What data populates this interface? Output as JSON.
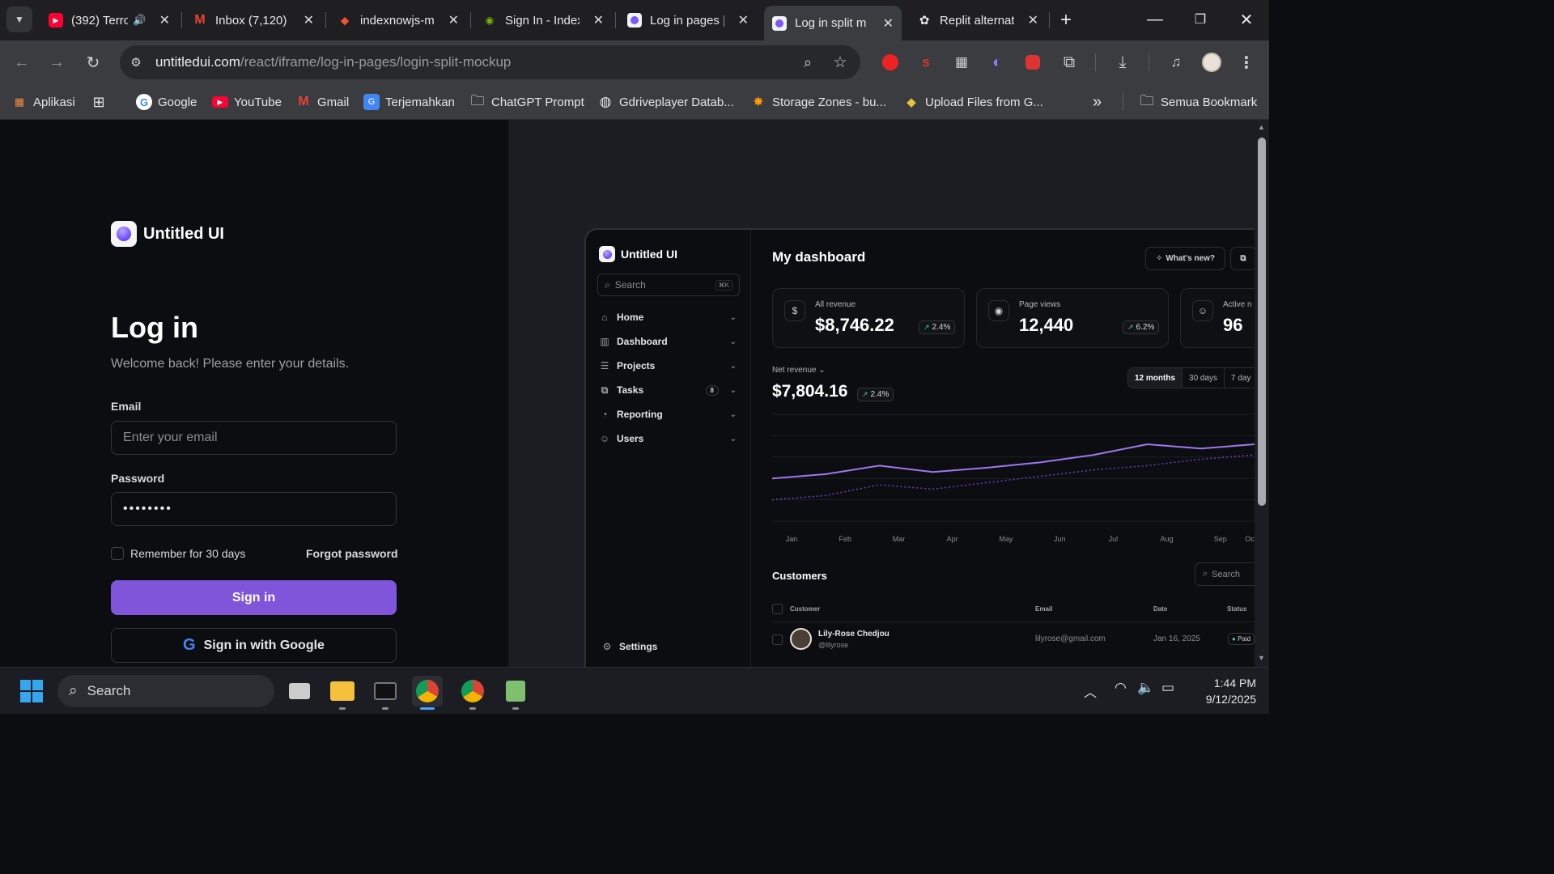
{
  "browser": {
    "tabs": [
      {
        "title": "(392) Terro",
        "icon": "youtube-icon"
      },
      {
        "title": "Inbox (7,120) -",
        "icon": "gmail-icon"
      },
      {
        "title": "indexnowjs-m",
        "icon": "git-icon"
      },
      {
        "title": "Sign In - Index",
        "icon": "nvidia-icon"
      },
      {
        "title": "Log in pages |",
        "icon": "untitledui-icon"
      },
      {
        "title": "Log in split m",
        "icon": "untitledui-icon"
      },
      {
        "title": "Replit alternat",
        "icon": "openai-icon"
      }
    ],
    "url_domain": "untitledui.com",
    "url_path": "/react/iframe/log-in-pages/login-split-mockup",
    "bookmarks": [
      "Aplikasi",
      "Google",
      "YouTube",
      "Gmail",
      "Terjemahkan",
      "ChatGPT Prompt",
      "Gdriveplayer Datab...",
      "Storage Zones - bu...",
      "Upload Files from G..."
    ],
    "all_bookmarks": "Semua Bookmark"
  },
  "login": {
    "brand": "Untitled UI",
    "heading": "Log in",
    "subtitle": "Welcome back! Please enter your details.",
    "email_label": "Email",
    "email_placeholder": "Enter your email",
    "password_label": "Password",
    "password_value": "••••••••",
    "remember": "Remember for 30 days",
    "forgot": "Forgot password",
    "signin": "Sign in",
    "google": "Sign in with Google"
  },
  "dashboard": {
    "brand": "Untitled UI",
    "search_placeholder": "Search",
    "search_shortcut": "⌘K",
    "nav": [
      {
        "label": "Home",
        "icon": "home-icon"
      },
      {
        "label": "Dashboard",
        "icon": "chart-icon"
      },
      {
        "label": "Projects",
        "icon": "layers-icon"
      },
      {
        "label": "Tasks",
        "icon": "tasks-icon",
        "badge": "8"
      },
      {
        "label": "Reporting",
        "icon": "pie-icon"
      },
      {
        "label": "Users",
        "icon": "users-icon"
      }
    ],
    "settings": "Settings",
    "title": "My dashboard",
    "whats_new": "What's new?",
    "cards": [
      {
        "label": "All revenue",
        "value": "$8,746.22",
        "change": "2.4%",
        "icon": "dollar-icon"
      },
      {
        "label": "Page views",
        "value": "12,440",
        "change": "6.2%",
        "icon": "eye-icon"
      },
      {
        "label": "Active n",
        "value": "96",
        "icon": "user-circle-icon"
      }
    ],
    "net_revenue_label": "Net revenue",
    "net_revenue_value": "$7,804.16",
    "net_revenue_change": "2.4%",
    "range_tabs": [
      "12 months",
      "30 days",
      "7 day"
    ],
    "customers_title": "Customers",
    "customers_search": "Search",
    "columns": [
      "Customer",
      "Email",
      "Date",
      "Status"
    ],
    "rows": [
      {
        "name": "Lily-Rose Chedjou",
        "handle": "@lilyrose",
        "email": "lilyrose@gmail.com",
        "date": "Jan 16, 2025",
        "status": "Paid"
      }
    ]
  },
  "chart_data": {
    "type": "line",
    "categories": [
      "Jan",
      "Feb",
      "Mar",
      "Apr",
      "May",
      "Jun",
      "Jul",
      "Aug",
      "Sep",
      "Oc"
    ],
    "series": [
      {
        "values": [
          40,
          44,
          52,
          46,
          50,
          55,
          62,
          72,
          68,
          72
        ]
      },
      {
        "values": [
          20,
          24,
          34,
          30,
          36,
          42,
          48,
          52,
          58,
          62
        ]
      }
    ],
    "ylim": [
      0,
      100
    ],
    "grid": true,
    "colors": {
      "primary": "#9e77ed",
      "secondary": "#6941c6"
    }
  },
  "taskbar": {
    "search": "Search",
    "time": "1:44 PM",
    "date": "9/12/2025"
  },
  "colors": {
    "accent": "#7f56d9",
    "success": "#47cd89"
  }
}
